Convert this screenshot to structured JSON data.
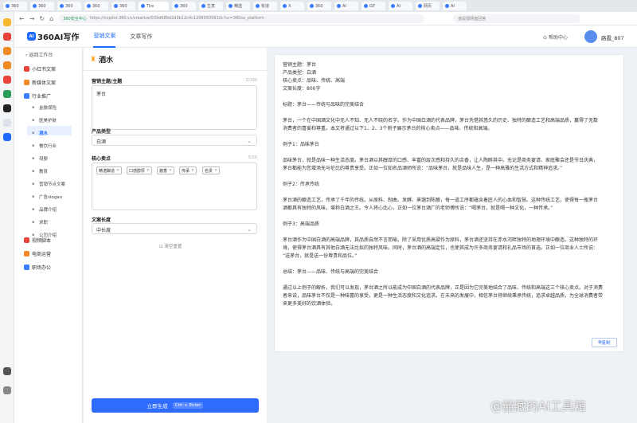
{
  "browser": {
    "tabs": [
      "360",
      "360",
      "360",
      "360",
      "360",
      "The",
      "360",
      "生意",
      "精选",
      "有道",
      "X",
      "360",
      "AI",
      "GP",
      "AI",
      "网页",
      "AI"
    ],
    "address": "https://copilot.360.cn/creative/039d689d2d0b12c4c12080505632c?sc=360se_platform",
    "address_safe": "360安全中心",
    "search_placeholder": "盛是很网盘回答"
  },
  "app": {
    "logo": "360AI写作",
    "tab_marketing": "营销文案",
    "tab_writing": "文章写作",
    "help": "帮助中心",
    "username": "路霞_807"
  },
  "sidebar": {
    "back": "返回工作台",
    "categories": [
      {
        "label": "小红书文案",
        "color": "#e8443b"
      },
      {
        "label": "新媒体文案",
        "color": "#f08a24"
      },
      {
        "label": "行业推广",
        "color": "#3a7bff"
      }
    ],
    "sub_items": [
      "金融保险",
      "医美护肤",
      "酒水",
      "餐饮行业",
      "母婴",
      "教育",
      "营销节点文案",
      "广告slogan",
      "品牌介绍",
      "求职",
      "公司介绍"
    ],
    "bottom_categories": [
      {
        "label": "视频脚本",
        "color": "#e8443b"
      },
      {
        "label": "电商运营",
        "color": "#f08a24"
      },
      {
        "label": "职场办公",
        "color": "#3a7bff"
      }
    ]
  },
  "form": {
    "title": "酒水",
    "theme_label": "营销主题/主题",
    "theme_count": "2/100",
    "theme_value": "茅台",
    "type_label": "产品类型",
    "type_value": "白酒",
    "core_label": "核心卖点",
    "core_count": "5/20",
    "tags": [
      "精湛酿造",
      "口感醇厚",
      "酱香",
      "传承",
      "名贵"
    ],
    "length_label": "文案长度",
    "length_value": "中长度",
    "clear": "清空重置",
    "generate": "立即生成",
    "shortcut": "Ctrl + Enter"
  },
  "result": {
    "lines": [
      "营销主题：茅台",
      "产品类型：白酒",
      "核心卖点：品味、传统、高端",
      "文案长度：800字",
      "",
      "标题：茅台——传统与品味的完美结合",
      "",
      "茅台，一个在中国酒文化中无人不知、无人不晓的名字。作为中国白酒的代表品牌，茅台凭借其悠久的历史、独特的酿造工艺和高端品质，赢得了无数",
      "消费者的喜爱和尊重。本文将通过以下1、2、3个例子展示茅台的核心卖点——品味、传统和高端。",
      "",
      "例子1：品味茅台",
      "",
      "品味茅台，就是品味一种生活态度。茅台酒以其醇厚的口感、丰富的层次感和持久的余香，让人陶醉其中。无论是商务宴请、家庭聚会还是节日庆典，",
      "茅台都能为您增添无与伦比的尊贵享受。正如一位知名品酒师所说：“品味茅台，就是品味人生，是一种高雅的生活方式和精神追求。”",
      "",
      "例子2：传承传统",
      "",
      "茅台酒的酿造工艺，传承了千年的传统。从原料、制曲、发酵、蒸馏到陈酿，每一道工序都蕴含着匠人的心血和智慧。这种传统工艺，使得每一瓶茅台",
      "酒都具有独特的风味，堪称白酒之王。今人将心比心，正如一位茅台酒厂的老师傅所说：“喝茅台，就是喝一种文化，一种传承。”",
      "",
      "例子3：高端品质",
      "",
      "茅台酒作为中国白酒的高端品牌，其品质自然不言而喻。除了采用优质高粱作为原料，茅台酒还坚持在赤水河畔独特的地理环境中酿造。这种独特的环",
      "境，使得茅台酒具有其他白酒无法比拟的独特风味。同时，茅台酒的高端定位，也使其成为许多商务宴请和礼品市场的首选。正如一位商业人士所说：",
      "“送茅台，就是送一份尊贵和品位。”",
      "",
      "总结：茅台——品味、传统与高端的完美结合",
      "",
      "通过以上例子的解析，我们可以发现，茅台酒之所以能成为中国白酒的代表品牌，正是因为它完美地结合了品味、传统和高端这三个核心卖点。对于消费",
      "者来说，品味茅台不仅是一种味蕾的享受，更是一种生活态度和文化追求。在未来的发展中，相信茅台将继续秉承传统，追求卓越品质，为全球消费者带",
      "来更多美好的饮酒体验。"
    ],
    "copy": "复制"
  },
  "watermark": "@囍藏的AI工具箱",
  "colors": {
    "accent": "#2e6bff"
  }
}
